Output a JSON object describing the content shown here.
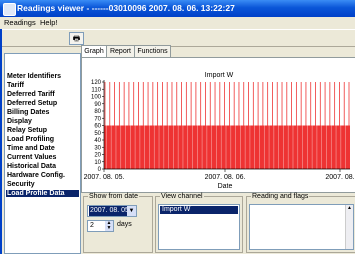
{
  "window": {
    "title": "Readings viewer - ------03010096  2007. 08. 06. 13:22:27"
  },
  "menu": [
    "Readings",
    "Help!"
  ],
  "toolbar": {
    "print_icon": "printer-icon"
  },
  "sidebar": {
    "items": [
      "Meter Identifiers",
      "Tariff",
      "Deferred Tariff",
      "Deferred Setup",
      "Billing Dates",
      "Display",
      "Relay Setup",
      "Load Profiling",
      "Time and Date",
      "Current Values",
      "Historical Data",
      "Hardware Config.",
      "Security",
      "Load Profile Data"
    ],
    "selected_index": 13
  },
  "tabs": [
    "Graph",
    "Report",
    "Functions"
  ],
  "active_tab": 0,
  "chart_data": {
    "type": "bar",
    "title": "Import W",
    "xlabel": "Date",
    "ylabel": "",
    "ylim": [
      0,
      120
    ],
    "yticks": [
      "0",
      "10",
      "20",
      "30",
      "40",
      "50",
      "60",
      "70",
      "80",
      "90",
      "100",
      "110",
      "120"
    ],
    "xticks": [
      "2007. 08. 05.",
      "2007. 08. 06.",
      "2007. 08."
    ],
    "grid": false,
    "series": [
      {
        "base_level": 60,
        "spike_level": 120,
        "color": "#ee3333"
      }
    ]
  },
  "controls": {
    "show_from_date_label": "Show from date",
    "from_date": "2007. 08. 05.",
    "days_value": "2",
    "days_label": "days",
    "view_channel_label": "View channel",
    "channels": [
      "Import W"
    ],
    "reading_flags_label": "Reading and flags"
  }
}
